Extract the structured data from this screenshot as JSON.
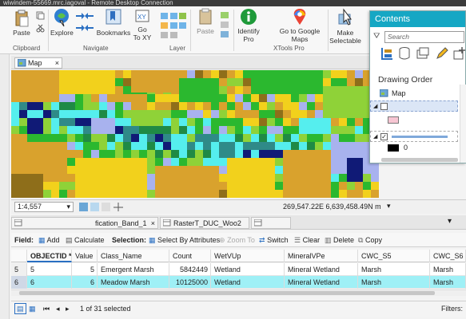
{
  "window": {
    "title": "wiwindem-55669.mrc.iagoval - Remote Desktop Connection"
  },
  "ribbon": {
    "clipboard": {
      "paste_label": "Paste",
      "group_label": "Clipboard"
    },
    "navigate": {
      "explore_label": "Explore",
      "bookmarks_label": "Bookmarks",
      "goto_xy_label": "Go\nTo XY",
      "group_label": "Navigate"
    },
    "layer": {
      "paste_label": "Paste",
      "group_label": "Layer"
    },
    "xtools": {
      "identify_label": "Identify Pro",
      "goto_google_label": "Go to Google Maps",
      "group_label": "XTools Pro"
    },
    "make_selectable_label": "Make Selectable"
  },
  "map": {
    "tab_label": "Map",
    "scale": "1:4,557",
    "coordinates": "269,547.22E 6,639,458.49N m",
    "colors": {
      "yellow": "#f2d11c",
      "tan": "#d9a22d",
      "green": "#2bb82f",
      "lightgreen": "#8fd238",
      "darkgreen": "#1f8a45",
      "cyan": "#55eeee",
      "lavender": "#a8b2ee",
      "navy": "#101a76",
      "teal": "#2f8a88",
      "olive": "#8e6e1a"
    }
  },
  "table_tabs": [
    {
      "label": "fication_Band_1"
    },
    {
      "label": "RasterT_DUC_Woo2"
    },
    {
      "label": ""
    }
  ],
  "field_toolbar": {
    "field_label": "Field:",
    "add_label": "Add",
    "calculate_label": "Calculate",
    "selection_label": "Selection:",
    "select_by_attr_label": "Select By Attributes",
    "zoom_to_label": "Zoom To",
    "switch_label": "Switch",
    "clear_label": "Clear",
    "delete_label": "Delete",
    "copy_label": "Copy"
  },
  "table": {
    "columns": [
      "OBJECTID *",
      "Value",
      "Class_Name",
      "Count",
      "WetVUp",
      "MineralVPe",
      "CWC_S5",
      "CWC_S6"
    ],
    "rows": [
      {
        "rownum": "5",
        "cells": [
          "5",
          "5",
          "Emergent Marsh",
          "5842449",
          "Wetland",
          "Mineral Wetland",
          "Marsh",
          "Marsh"
        ]
      },
      {
        "rownum": "6",
        "cells": [
          "6",
          "6",
          "Meadow Marsh",
          "10125000",
          "Wetland",
          "Mineral Wetland",
          "Marsh",
          "Marsh"
        ]
      }
    ]
  },
  "footer": {
    "selected_text": "1 of 31 selected",
    "filters_label": "Filters:"
  },
  "contents": {
    "title": "Contents",
    "search_placeholder": "Search",
    "drawing_order_label": "Drawing Order",
    "map_item_label": "Map",
    "legend_value": "0",
    "colors": {
      "header": "#15a7c4",
      "pink": "#f7c6d3"
    }
  }
}
